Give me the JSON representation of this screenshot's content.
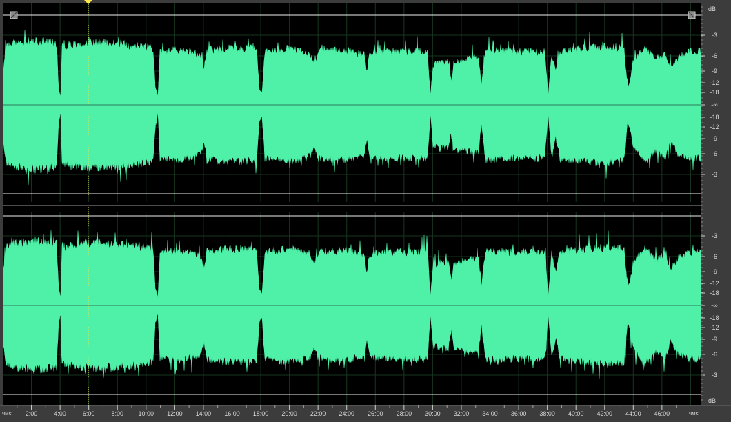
{
  "editor": {
    "wave_color": "#4ff0a8",
    "background_color": "#000000",
    "panel_color": "#3c3c3c",
    "grid_color": "#17361f",
    "playhead_color": "#ffe84a"
  },
  "db_ruler": {
    "unit_top": "dB",
    "unit_bottom": "dB",
    "labels_upper": [
      "-3",
      "-6",
      "-9",
      "-12",
      "-18",
      "-∞",
      "-18",
      "-12",
      "-9",
      "-6",
      "-3"
    ],
    "labels_lower": [
      "-3",
      "-6",
      "-9",
      "-12",
      "-18",
      "-∞",
      "-18",
      "-12",
      "-9",
      "-6",
      "-3"
    ]
  },
  "time_ruler": {
    "unit_start": "чмс",
    "unit_end": "чмс",
    "labels": [
      "2:00",
      "4:00",
      "6:00",
      "8:00",
      "10:00",
      "12:00",
      "14:00",
      "16:00",
      "18:00",
      "20:00",
      "22:00",
      "24:00",
      "26:00",
      "28:00",
      "30:00",
      "32:00",
      "34:00",
      "36:00",
      "38:00",
      "40:00",
      "42:00",
      "44:00",
      "46:00"
    ],
    "playhead_time": "6:00"
  }
}
